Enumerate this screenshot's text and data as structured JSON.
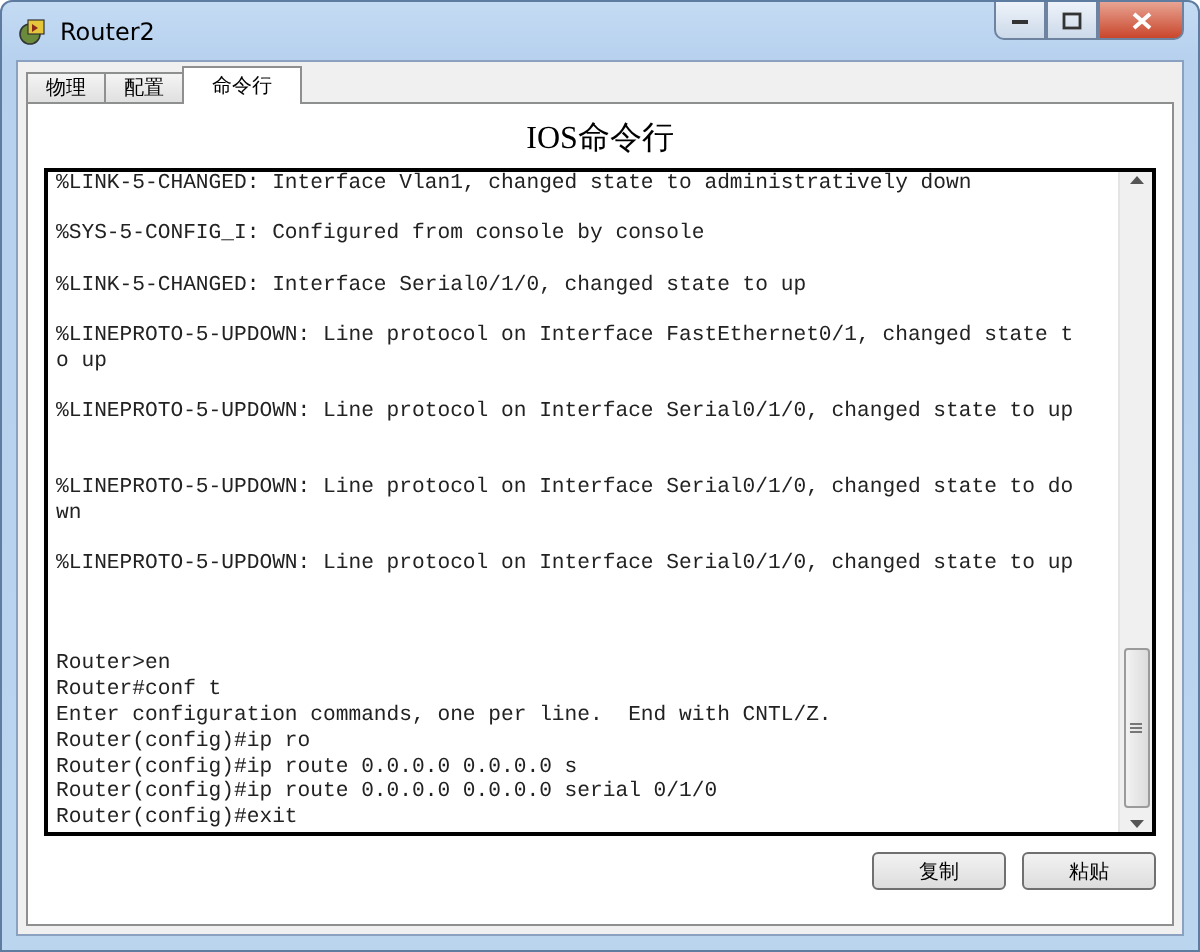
{
  "window": {
    "title": "Router2"
  },
  "tabs": [
    {
      "label": "物理",
      "selected": false
    },
    {
      "label": "配置",
      "selected": false
    },
    {
      "label": "命令行",
      "selected": true
    }
  ],
  "heading": "IOS命令行",
  "terminal": {
    "lines": [
      {
        "kind": "text",
        "text": "%LINK-5-CHANGED: Interface Vlan1, changed state to administratively down"
      },
      {
        "kind": "blank"
      },
      {
        "kind": "text",
        "text": "%SYS-5-CONFIG_I: Configured from console by console"
      },
      {
        "kind": "blank"
      },
      {
        "kind": "text",
        "text": "%LINK-5-CHANGED: Interface Serial0/1/0, changed state to up"
      },
      {
        "kind": "blank"
      },
      {
        "kind": "text",
        "text": "%LINEPROTO-5-UPDOWN: Line protocol on Interface FastEthernet0/1, changed state t"
      },
      {
        "kind": "text",
        "text": "o up"
      },
      {
        "kind": "blank"
      },
      {
        "kind": "text",
        "text": "%LINEPROTO-5-UPDOWN: Line protocol on Interface Serial0/1/0, changed state to up"
      },
      {
        "kind": "blank"
      },
      {
        "kind": "blank"
      },
      {
        "kind": "text",
        "text": "%LINEPROTO-5-UPDOWN: Line protocol on Interface Serial0/1/0, changed state to do"
      },
      {
        "kind": "text",
        "text": "wn"
      },
      {
        "kind": "blank"
      },
      {
        "kind": "text",
        "text": "%LINEPROTO-5-UPDOWN: Line protocol on Interface Serial0/1/0, changed state to up"
      },
      {
        "kind": "blank"
      },
      {
        "kind": "blank"
      },
      {
        "kind": "blank"
      },
      {
        "kind": "text",
        "text": "Router>en"
      },
      {
        "kind": "text",
        "text": "Router#conf t"
      },
      {
        "kind": "text",
        "text": "Enter configuration commands, one per line.  End with CNTL/Z."
      },
      {
        "kind": "text",
        "text": "Router(config)#ip ro"
      },
      {
        "kind": "text",
        "text": "Router(config)#ip route 0.0.0.0 0.0.0.0 s"
      },
      {
        "kind": "text",
        "text": "Router(config)#ip route 0.0.0.0 0.0.0.0 serial 0/1/0"
      },
      {
        "kind": "text",
        "text": "Router(config)#exit"
      }
    ]
  },
  "buttons": [
    "复制",
    "粘贴"
  ]
}
